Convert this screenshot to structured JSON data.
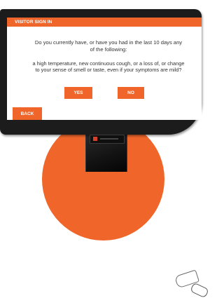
{
  "header": {
    "title": "VISITOR SIGN IN"
  },
  "question": {
    "prompt": "Do you currently have, or have you had in the last 10 days any of the following:",
    "symptoms": "a high temperature, new continuous cough, or a loss of, or change to your sense of smell or taste, even if your symptoms are mild?"
  },
  "buttons": {
    "yes": "YES",
    "no": "NO",
    "back": "BACK"
  },
  "colors": {
    "accent": "#f0662a",
    "bezel": "#1c1c1c",
    "text": "#333333"
  }
}
